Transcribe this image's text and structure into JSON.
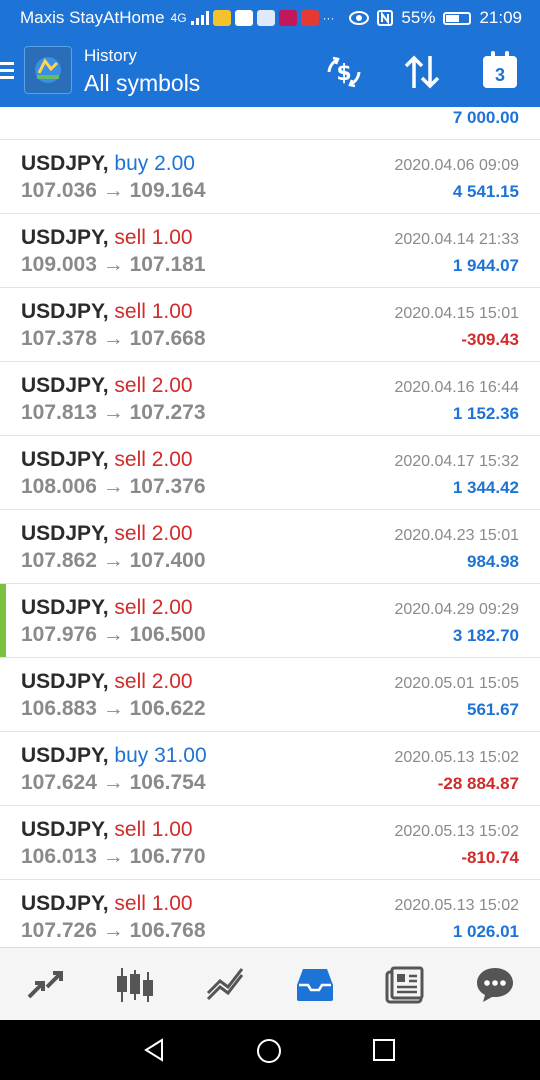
{
  "status_bar": {
    "carrier": "Maxis StayAtHome",
    "network": "4G",
    "battery": "55%",
    "battery_level": 0.55,
    "time": "21:09"
  },
  "app_bar": {
    "title": "History",
    "subtitle": "All symbols",
    "calendar_day": "3",
    "accent": "#1e73d6"
  },
  "partial_row": {
    "profit": "7 000.00"
  },
  "trades": [
    {
      "symbol": "USDJPY,",
      "side": "buy",
      "volume": "buy 2.00",
      "open": "107.036",
      "close": "109.164",
      "date": "2020.04.06 09:09",
      "profit": "4 541.15",
      "pos": true
    },
    {
      "symbol": "USDJPY,",
      "side": "sell",
      "volume": "sell 1.00",
      "open": "109.003",
      "close": "107.181",
      "date": "2020.04.14 21:33",
      "profit": "1 944.07",
      "pos": true
    },
    {
      "symbol": "USDJPY,",
      "side": "sell",
      "volume": "sell 1.00",
      "open": "107.378",
      "close": "107.668",
      "date": "2020.04.15 15:01",
      "profit": "-309.43",
      "pos": false
    },
    {
      "symbol": "USDJPY,",
      "side": "sell",
      "volume": "sell 2.00",
      "open": "107.813",
      "close": "107.273",
      "date": "2020.04.16 16:44",
      "profit": "1 152.36",
      "pos": true
    },
    {
      "symbol": "USDJPY,",
      "side": "sell",
      "volume": "sell 2.00",
      "open": "108.006",
      "close": "107.376",
      "date": "2020.04.17 15:32",
      "profit": "1 344.42",
      "pos": true
    },
    {
      "symbol": "USDJPY,",
      "side": "sell",
      "volume": "sell 2.00",
      "open": "107.862",
      "close": "107.400",
      "date": "2020.04.23 15:01",
      "profit": "984.98",
      "pos": true
    },
    {
      "symbol": "USDJPY,",
      "side": "sell",
      "volume": "sell 2.00",
      "open": "107.976",
      "close": "106.500",
      "date": "2020.04.29 09:29",
      "profit": "3 182.70",
      "pos": true,
      "selected": true
    },
    {
      "symbol": "USDJPY,",
      "side": "sell",
      "volume": "sell 2.00",
      "open": "106.883",
      "close": "106.622",
      "date": "2020.05.01 15:05",
      "profit": "561.67",
      "pos": true
    },
    {
      "symbol": "USDJPY,",
      "side": "buy",
      "volume": "buy 31.00",
      "open": "107.624",
      "close": "106.754",
      "date": "2020.05.13 15:02",
      "profit": "-28 884.87",
      "pos": false
    },
    {
      "symbol": "USDJPY,",
      "side": "sell",
      "volume": "sell 1.00",
      "open": "106.013",
      "close": "106.770",
      "date": "2020.05.13 15:02",
      "profit": "-810.74",
      "pos": false
    },
    {
      "symbol": "USDJPY,",
      "side": "sell",
      "volume": "sell 1.00",
      "open": "107.726",
      "close": "106.768",
      "date": "2020.05.13 15:02",
      "profit": "1 026.01",
      "pos": true
    }
  ],
  "bottom_nav": [
    {
      "name": "quotes-icon",
      "active": false
    },
    {
      "name": "chart-icon",
      "active": false
    },
    {
      "name": "trade-icon",
      "active": false
    },
    {
      "name": "history-icon",
      "active": true
    },
    {
      "name": "news-icon",
      "active": false
    },
    {
      "name": "messages-icon",
      "active": false
    }
  ]
}
